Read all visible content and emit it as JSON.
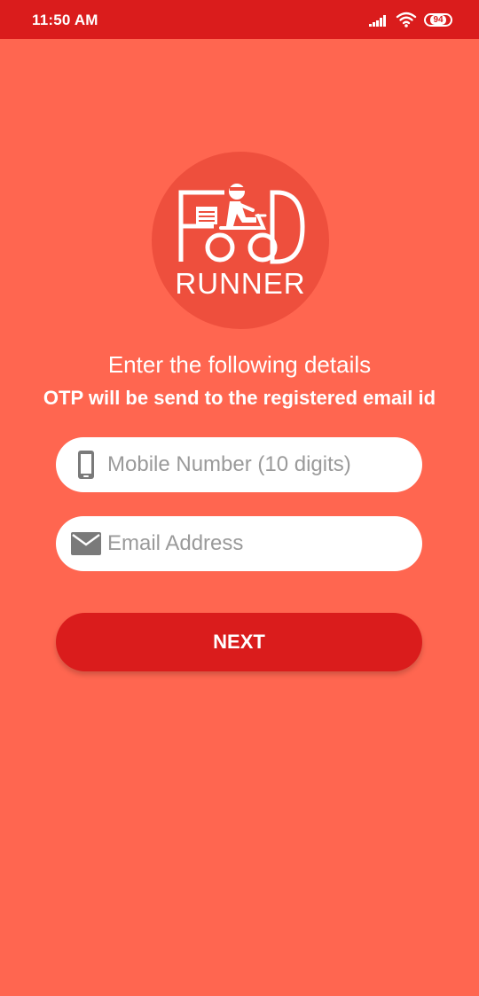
{
  "status_bar": {
    "time": "11:50 AM",
    "battery": "94",
    "icons": [
      "signal-icon",
      "wifi-icon",
      "battery-icon"
    ]
  },
  "logo": {
    "subtitle": "RUNNER",
    "icon": "food-delivery-rider-icon"
  },
  "form": {
    "heading": "Enter the following details",
    "subheading": "OTP will be send to the registered email id",
    "mobile": {
      "placeholder": "Mobile Number (10 digits)",
      "value": "",
      "icon": "phone-icon"
    },
    "email": {
      "placeholder": "Email Address",
      "value": "",
      "icon": "email-icon"
    },
    "next_label": "NEXT"
  },
  "colors": {
    "background": "#FF6650",
    "status_bar": "#DA1C1C",
    "button": "#DA1C1C",
    "logo_circle": "#EE4F3D"
  }
}
